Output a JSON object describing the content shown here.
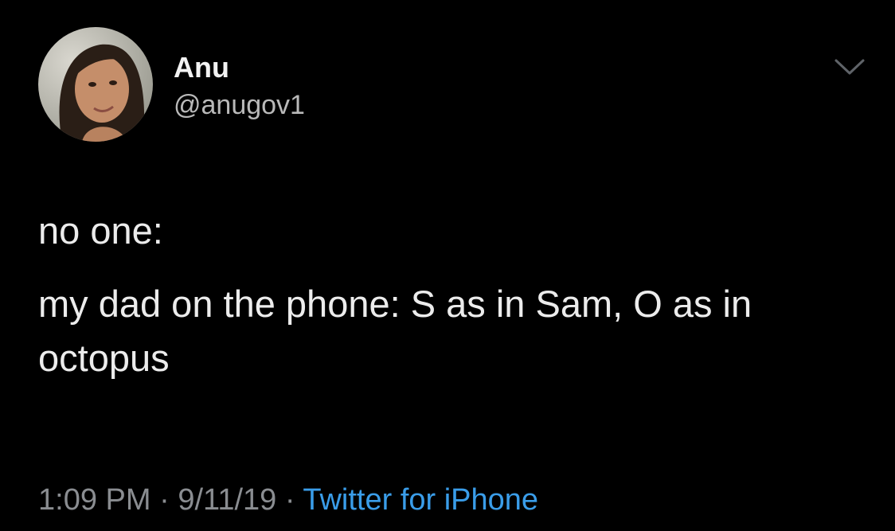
{
  "tweet": {
    "author": {
      "display_name": "Anu",
      "handle": "@anugov1"
    },
    "text_line1": "no one:",
    "text_line2": "my dad on the phone: S as in Sam, O as in octopus",
    "time": "1:09 PM",
    "separator": "·",
    "date": "9/11/19",
    "source": "Twitter for iPhone"
  },
  "icons": {
    "caret": "chevron-down-icon"
  },
  "colors": {
    "background": "#000000",
    "text": "#ececec",
    "muted": "#8a8d91",
    "link": "#3a9de9"
  }
}
